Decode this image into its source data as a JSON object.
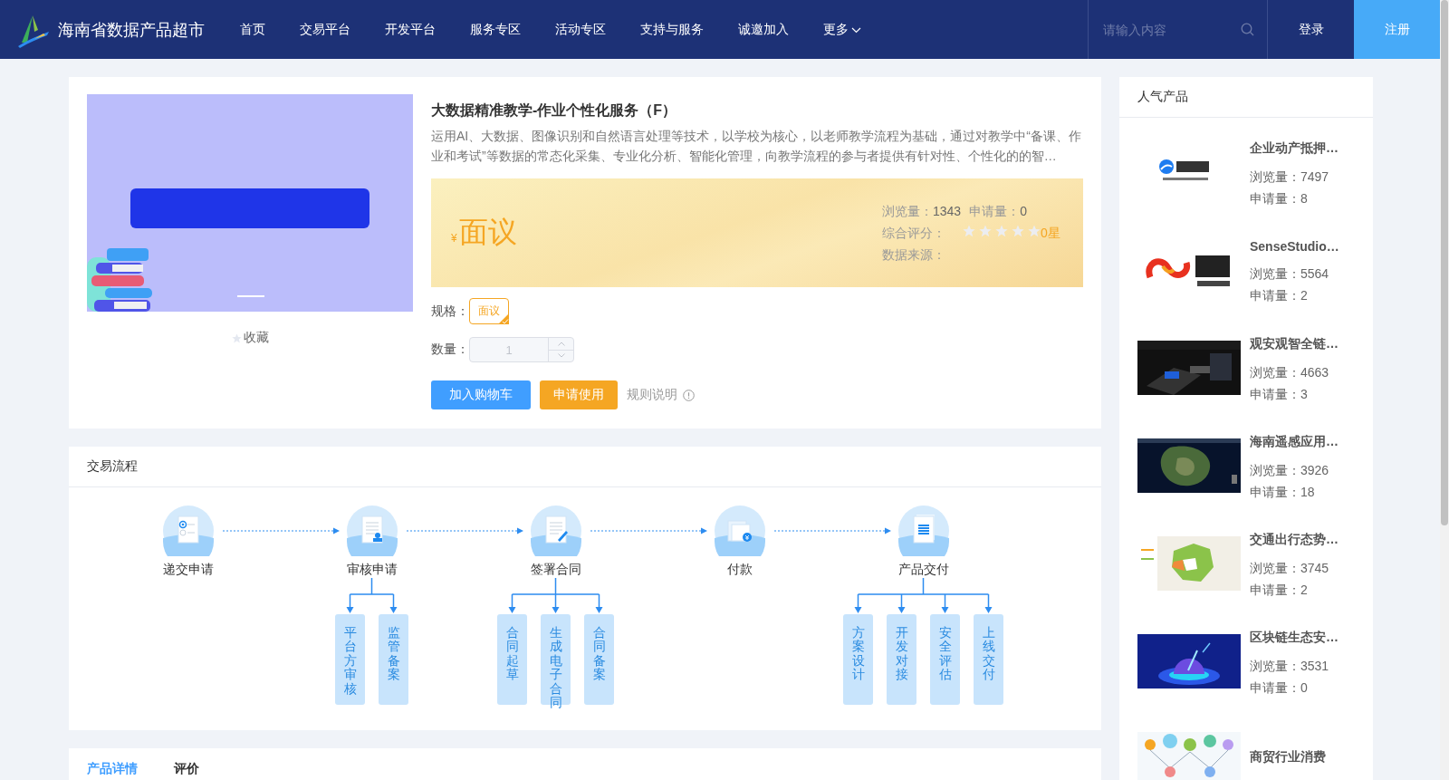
{
  "header": {
    "site_title": "海南省数据产品超市",
    "nav": [
      {
        "label": "首页",
        "dropdown": false
      },
      {
        "label": "交易平台",
        "dropdown": false
      },
      {
        "label": "开发平台",
        "dropdown": false
      },
      {
        "label": "服务专区",
        "dropdown": false
      },
      {
        "label": "活动专区",
        "dropdown": false
      },
      {
        "label": "支持与服务",
        "dropdown": false
      },
      {
        "label": "诚邀加入",
        "dropdown": false
      },
      {
        "label": "更多",
        "dropdown": true
      }
    ],
    "search": {
      "placeholder": "请输入内容"
    },
    "login": "登录",
    "register": "注册"
  },
  "product": {
    "favorite": "收藏",
    "title": "大数据精准教学-作业个性化服务（F）",
    "description": "运用AI、大数据、图像识别和自然语言处理等技术，以学校为核心，以老师教学流程为基础，通过对教学中“备课、作业和考试”等数据的常态化采集、专业化分析、智能化管理，向教学流程的参与者提供有针对性、个性化的的智…",
    "price_symbol": "¥",
    "price": "面议",
    "views_label": "浏览量：",
    "views": "1343",
    "applications_label": "申请量：",
    "applications": "0",
    "rating_label": "综合评分：",
    "stars": 0,
    "rating_text": "0星",
    "source_label": "数据来源：",
    "spec_label": "规格：",
    "specs": [
      {
        "label": "面议",
        "selected": true
      }
    ],
    "quantity_label": "数量：",
    "quantity": {
      "value": "1",
      "disabled": true
    },
    "buttons": [
      {
        "label": "加入购物车",
        "kind": "primary"
      },
      {
        "label": "申请使用",
        "kind": "warning"
      }
    ],
    "rules_link": "规则说明"
  },
  "process": {
    "title": "交易流程",
    "steps": [
      {
        "label": "递交申请",
        "kind": "form"
      },
      {
        "label": "审核申请",
        "kind": "review",
        "children": [
          "平台方审核",
          "监管备案"
        ]
      },
      {
        "label": "签署合同",
        "kind": "sign",
        "children": [
          "合同起草",
          "生成电子合同",
          "合同备案"
        ]
      },
      {
        "label": "付款",
        "kind": "pay"
      },
      {
        "label": "产品交付",
        "kind": "deliver",
        "children": [
          "方案设计",
          "开发对接",
          "安全评估",
          "上线交付"
        ]
      }
    ]
  },
  "tabs": [
    {
      "label": "产品详情",
      "selected": true
    },
    {
      "label": "评价",
      "selected": false
    }
  ],
  "popular": {
    "title": "人气产品",
    "items": [
      {
        "title": "企业动产抵押…",
        "views": "浏览量：7497",
        "applications": "申请量：8"
      },
      {
        "title": "SenseStudio…",
        "views": "浏览量：5564",
        "applications": "申请量：2"
      },
      {
        "title": "观安观智全链…",
        "views": "浏览量：4663",
        "applications": "申请量：3"
      },
      {
        "title": "海南遥感应用…",
        "views": "浏览量：3926",
        "applications": "申请量：18"
      },
      {
        "title": "交通出行态势…",
        "views": "浏览量：3745",
        "applications": "申请量：2"
      },
      {
        "title": "区块链生态安…",
        "views": "浏览量：3531",
        "applications": "申请量：0"
      },
      {
        "title": "商贸行业消费"
      }
    ]
  }
}
